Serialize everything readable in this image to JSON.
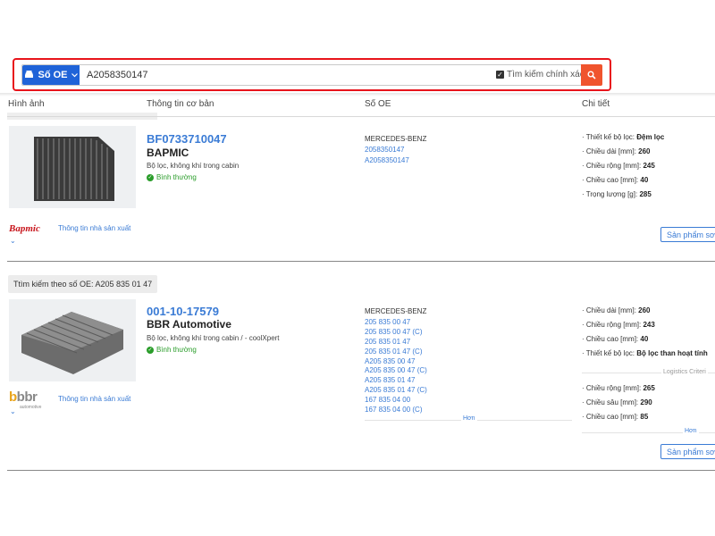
{
  "search": {
    "type_label": "Số OE",
    "query": "A2058350147",
    "exact_label": "Tìm kiếm chính xác",
    "exact_checked": true
  },
  "columns": {
    "image": "Hình ảnh",
    "basic": "Thông tin cơ bản",
    "oe": "Số OE",
    "details": "Chi tiết"
  },
  "products": [
    {
      "id": "BF0733710047",
      "brand": "BAPMIC",
      "description": "Bộ lọc, không khí trong cabin",
      "status": "Bình thường",
      "manufacturer_link": "Thông tin nhà sản xuất",
      "logo_text": "Bapmic",
      "oe_brand": "MERCEDES-BENZ",
      "oe_numbers": [
        "2058350147",
        "A2058350147"
      ],
      "details": [
        {
          "label": "Thiết kế bộ lọc:",
          "value": "Đệm lọc"
        },
        {
          "label": "Chiều dài [mm]:",
          "value": "260"
        },
        {
          "label": "Chiều rộng [mm]:",
          "value": "245"
        },
        {
          "label": "Chiều cao [mm]:",
          "value": "40"
        },
        {
          "label": "Trọng lượng [g]:",
          "value": "285"
        }
      ],
      "similar_button": "Sản phẩm sơ"
    },
    {
      "search_tag": "Ttìm kiếm theo số OE: A205 835 01 47",
      "id": "001-10-17579",
      "brand": "BBR Automotive",
      "description": "Bộ lọc, không khí trong cabin / - coolXpert",
      "status": "Bình thường",
      "manufacturer_link": "Thông tin nhà sản xuất",
      "logo_text": "bbr",
      "logo_sub": "automotive",
      "oe_brand": "MERCEDES-BENZ",
      "oe_numbers": [
        "205 835 00 47",
        "205 835 00 47 (C)",
        "205 835 01 47",
        "205 835 01 47 (C)",
        "A205 835 00 47",
        "A205 835 00 47 (C)",
        "A205 835 01 47",
        "A205 835 01 47 (C)",
        "167 835 04 00",
        "167 835 04 00 (C)"
      ],
      "oe_more": "Hơn",
      "details": [
        {
          "label": "Chiều dài [mm]:",
          "value": "260"
        },
        {
          "label": "Chiều rộng [mm]:",
          "value": "243"
        },
        {
          "label": "Chiều cao [mm]:",
          "value": "40"
        },
        {
          "label": "Thiết kế bộ lọc:",
          "value": "Bộ lọc than hoạt tính"
        }
      ],
      "logistics_label": "Logistics Criteri",
      "logistics": [
        {
          "label": "Chiều rộng [mm]:",
          "value": "265"
        },
        {
          "label": "Chiều sâu [mm]:",
          "value": "290"
        },
        {
          "label": "Chiều cao [mm]:",
          "value": "85"
        }
      ],
      "details_more": "Hơn",
      "similar_button": "Sản phẩm sơ"
    }
  ],
  "colors": {
    "accent": "#1f63d8",
    "link": "#3a7bd5",
    "search_button": "#f0542d",
    "highlight_border": "#e8141b",
    "status_ok": "#2a9d2a"
  }
}
